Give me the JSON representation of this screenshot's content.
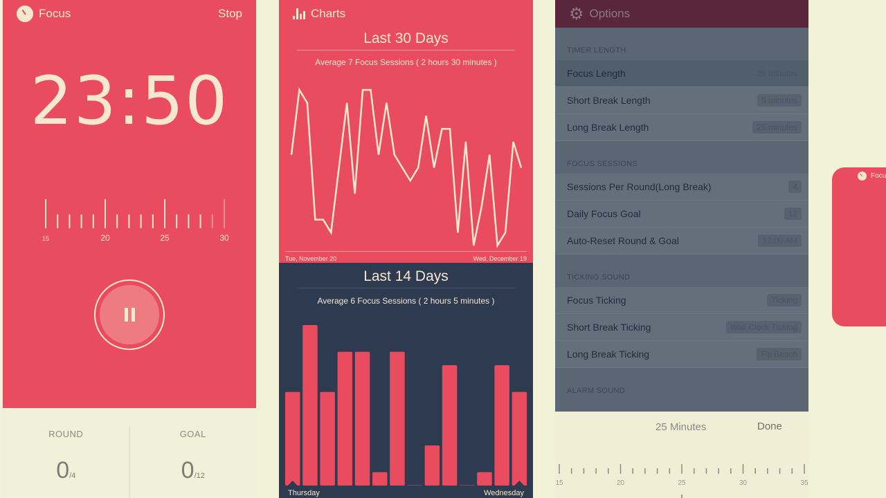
{
  "focus": {
    "title": "Focus",
    "stop_label": "Stop",
    "time": "23:50",
    "ruler": {
      "labels": [
        "15",
        "20",
        "25",
        "30"
      ],
      "value": 25
    },
    "round_label": "ROUND",
    "round_value": "0",
    "round_total": "/4",
    "goal_label": "GOAL",
    "goal_value": "0",
    "goal_total": "/12",
    "icon": "stopwatch-icon"
  },
  "charts": {
    "title": "Charts",
    "icon": "bar-chart-icon"
  },
  "chart_data": [
    {
      "type": "line",
      "title": "Last 30 Days",
      "subtitle": "Average 7 Focus Sessions ( 2 hours 30 minutes )",
      "x_start_label": "Tue, November 20",
      "x_end_label": "Wed, December 19",
      "values": [
        7,
        12,
        11,
        2,
        2,
        1,
        6,
        11,
        4,
        12,
        12,
        7,
        11,
        7,
        6,
        5,
        6,
        10,
        6,
        9,
        9,
        1,
        8,
        0,
        3,
        7,
        0,
        1,
        8,
        6
      ],
      "ylim": [
        0,
        12
      ],
      "line_color": "#f6e8d0"
    },
    {
      "type": "bar",
      "title": "Last 14 Days",
      "subtitle": "Average 6 Focus Sessions ( 2 hours 5 minutes )",
      "x_start_label": "Thursday",
      "x_end_label": "Wednesday",
      "values": [
        7,
        12,
        7,
        10,
        10,
        1,
        10,
        0,
        3,
        9,
        0,
        1,
        9,
        7
      ],
      "ylim": [
        0,
        12
      ],
      "bar_color": "#e94c5f"
    }
  ],
  "options": {
    "title": "Options",
    "icon": "gear-icon",
    "sections": [
      {
        "header": "TIMER LENGTH",
        "rows": [
          {
            "label": "Focus Length",
            "value": "25 minutes",
            "selected": true
          },
          {
            "label": "Short Break Length",
            "value": "5 minutes"
          },
          {
            "label": "Long Break Length",
            "value": "25 minutes"
          }
        ]
      },
      {
        "header": "FOCUS SESSIONS",
        "rows": [
          {
            "label": "Sessions Per Round(Long Break)",
            "value": "4"
          },
          {
            "label": "Daily Focus Goal",
            "value": "12"
          },
          {
            "label": "Auto-Reset Round & Goal",
            "value": "12:00 AM"
          }
        ]
      },
      {
        "header": "TICKING SOUND",
        "rows": [
          {
            "label": "Focus Ticking",
            "value": "Ticking"
          },
          {
            "label": "Short Break Ticking",
            "value": "Wall Clock Ticking"
          },
          {
            "label": "Long Break Ticking",
            "value": "Fiji Beach"
          }
        ]
      },
      {
        "header": "ALARM SOUND",
        "rows": []
      }
    ],
    "picker": {
      "value_label": "25 Minutes",
      "done_label": "Done",
      "labels": [
        "15",
        "20",
        "25",
        "30",
        "35"
      ],
      "value": 25
    }
  },
  "preview": {
    "title": "Focus"
  },
  "colors": {
    "accent": "#e94c5f",
    "dark": "#2e3a4f",
    "cream": "#f2f2d9",
    "options_header": "#5a263b"
  }
}
